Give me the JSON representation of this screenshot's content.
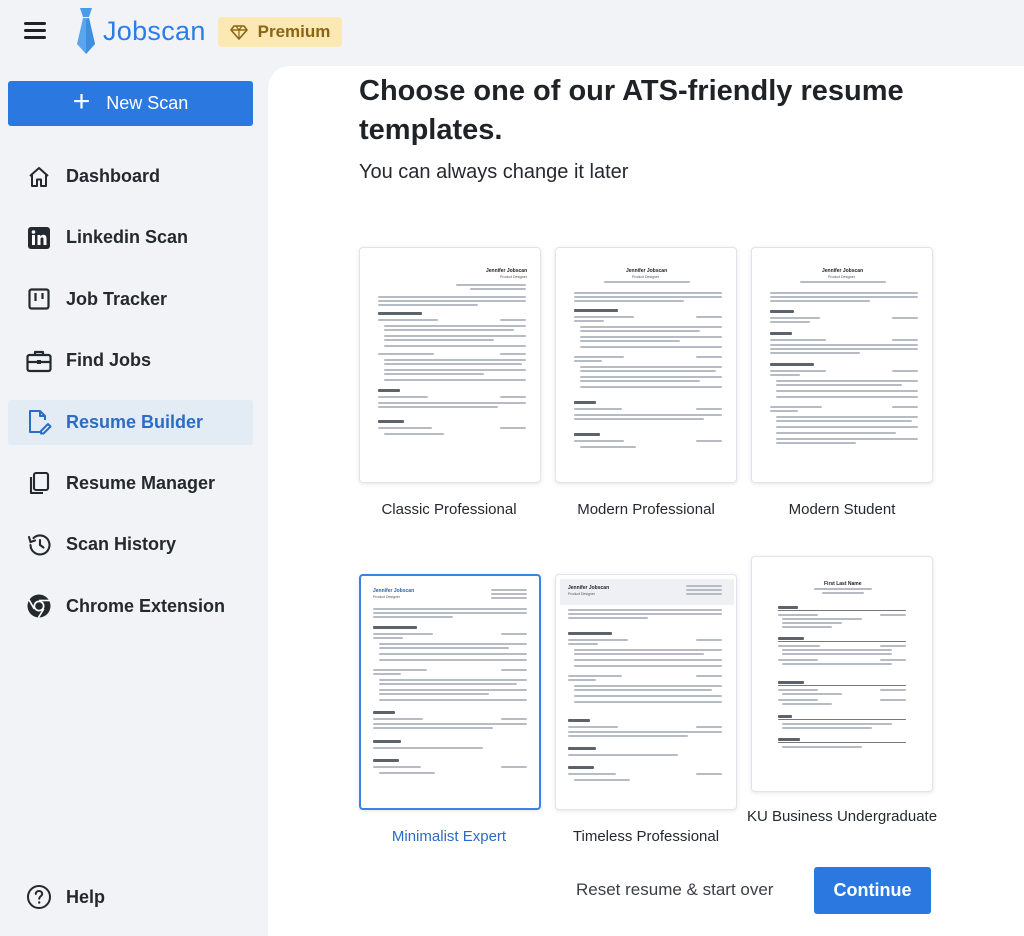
{
  "app": {
    "brand": "Jobscan",
    "premium_label": "Premium"
  },
  "sidebar": {
    "new_scan_label": "New Scan",
    "items": [
      {
        "label": "Dashboard",
        "icon": "home-icon"
      },
      {
        "label": "Linkedin Scan",
        "icon": "linkedin-icon"
      },
      {
        "label": "Job Tracker",
        "icon": "kanban-icon"
      },
      {
        "label": "Find Jobs",
        "icon": "briefcase-icon"
      },
      {
        "label": "Resume Builder",
        "icon": "edit-document-icon",
        "active": true
      },
      {
        "label": "Resume Manager",
        "icon": "copy-icon"
      },
      {
        "label": "Scan History",
        "icon": "history-icon"
      },
      {
        "label": "Chrome Extension",
        "icon": "chrome-icon"
      }
    ],
    "help_label": "Help"
  },
  "main": {
    "title": "Choose one of our ATS-friendly resume templates.",
    "subtitle": "You can always change it later",
    "templates": [
      {
        "label": "Classic Professional"
      },
      {
        "label": "Modern Professional"
      },
      {
        "label": "Modern Student"
      },
      {
        "label": "Minimalist Expert",
        "selected": true
      },
      {
        "label": "Timeless Professional"
      },
      {
        "label": "KU Business Undergraduate"
      }
    ],
    "preview_name": "Jennifer Jobscan",
    "preview_role": "Product Designer",
    "preview_name_ku": "First Last Name",
    "reset_label": "Reset resume & start over",
    "continue_label": "Continue"
  },
  "colors": {
    "accent": "#2b79e0",
    "active_bg": "#e3ebf5",
    "active_text": "#2b6cc4",
    "premium_bg": "#fbe8b2",
    "premium_text": "#8a6514"
  }
}
